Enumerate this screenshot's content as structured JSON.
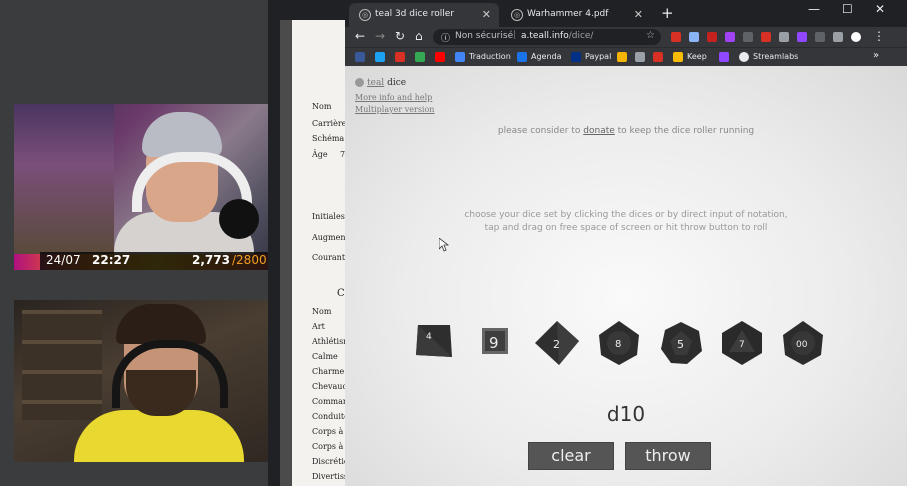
{
  "stream": {
    "cam1_overlay": {
      "date": "24/07",
      "time": "22:27",
      "count": "2,773",
      "goal": "/2800"
    }
  },
  "sheet": {
    "rows_top": [
      "Nom",
      "Carrière",
      "Schéma",
      "Âge",
      "Initiales",
      "Augmentat",
      "Courante"
    ],
    "age_value": "7",
    "section_letter": "C",
    "skills": [
      "Nom",
      "Art",
      "Athlétisme",
      "Calme",
      "Charme",
      "Chevauch",
      "Commande",
      "Conduite",
      "Corps à c",
      "Corps à",
      "Discrétion",
      "Divertissem"
    ]
  },
  "browser": {
    "tabs": [
      {
        "label": "teal 3d dice roller",
        "active": true
      },
      {
        "label": "Warhammer 4.pdf",
        "active": false
      }
    ],
    "address": {
      "security": "Non sécurisé",
      "url_host": "a.teall.info",
      "url_path": "/dice/"
    },
    "bookmarks": [
      {
        "label": "",
        "color": "#3b5998"
      },
      {
        "label": "",
        "color": "#1da1f2"
      },
      {
        "label": "",
        "color": "#d93025"
      },
      {
        "label": "",
        "color": "#34a853"
      },
      {
        "label": "",
        "color": "#ff0000"
      },
      {
        "label": "Traduction",
        "color": "#4285f4"
      },
      {
        "label": "Agenda",
        "color": "#1a73e8"
      },
      {
        "label": "Paypal",
        "color": "#003087"
      },
      {
        "label": "",
        "color": "#f4b400"
      },
      {
        "label": "",
        "color": "#9aa0a6"
      },
      {
        "label": "",
        "color": "#d93025"
      },
      {
        "label": "Keep",
        "color": "#fbbc04"
      },
      {
        "label": "",
        "color": "#9146ff"
      },
      {
        "label": "Streamlabs",
        "color": "#80f5d2"
      }
    ]
  },
  "page": {
    "brand_prefix": "teal",
    "brand_name": "dice",
    "link_more": "More info and help",
    "link_multi": "Multiplayer version",
    "donate_before": "please consider to ",
    "donate_link": "donate",
    "donate_after": " to keep the dice roller running",
    "help_line1": "choose your dice set by clicking the dices or by direct input of notation,",
    "help_line2": "tap and drag on free space of screen or hit throw button to roll",
    "dice": [
      {
        "type": "d4",
        "label": "4"
      },
      {
        "type": "d6",
        "label": "9"
      },
      {
        "type": "d8",
        "label": "2"
      },
      {
        "type": "d10",
        "label": "8"
      },
      {
        "type": "d12",
        "label": "5"
      },
      {
        "type": "d20",
        "label": "7"
      },
      {
        "type": "d100",
        "label": "00"
      }
    ],
    "notation": "d10",
    "clear_label": "clear",
    "throw_label": "throw"
  }
}
